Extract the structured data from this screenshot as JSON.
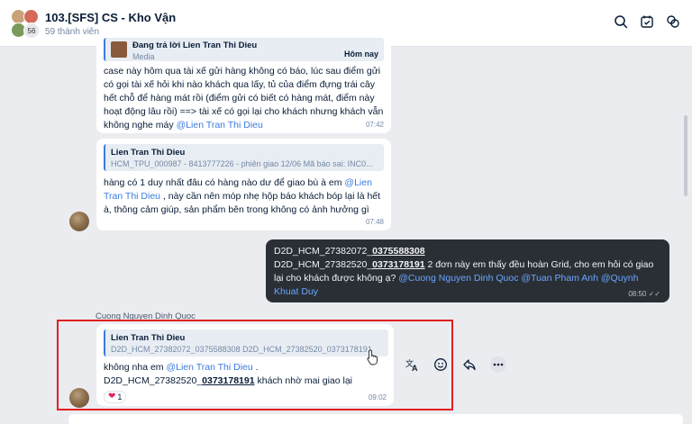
{
  "header": {
    "title": "103.[SFS] CS - Kho Vận",
    "members": "59 thành viên",
    "avatar_count": "56",
    "icons": [
      "search-icon",
      "calendar-check-icon",
      "sync-chat-icon"
    ]
  },
  "messages": {
    "m1": {
      "reply_label": "Đang trả lời Lien Tran Thi Dieu",
      "reply_sub": "Media",
      "reply_time": "Hôm nay",
      "text": "case này hôm qua tài xế gửi hàng không có báo, lúc sau điểm gửi có gọi tài xế hỏi khi nào khách qua lấy, tủ của điểm đựng trái cây hết chỗ để hàng mát rồi (điểm gửi có biết có hàng mát, điểm này hoạt động lâu rồi) ==> tài xế có gọi lại cho khách nhưng khách vẫn không nghe máy",
      "mention": "@Lien Tran Thi Dieu",
      "time": "07:42"
    },
    "m2": {
      "quote_name": "Lien Tran Thi Dieu",
      "quote_text": "HCM_TPU_000987 - 8413777226 - phiên giao 12/06 Mã báo sai: INC0...",
      "text_a": "hàng có 1 duy nhất đâu có hàng nào dư để giao bù à em ",
      "mention": "@Lien Tran Thi Dieu",
      "text_b": " , này cần nên móp nhẹ hộp báo khách bóp lại là hết à, thông cảm giúp, sản phẩm bên trong không có ảnh hưởng gì",
      "time": "07:48"
    },
    "m3": {
      "line1_a": "D2D_HCM_27382072_",
      "line1_b": "0375588308",
      "line2_a": "D2D_HCM_27382520_",
      "line2_b": "0373178191",
      "line2_c": " 2 đơn này em thấy đều hoàn Grid, cho em hỏi có giao lại cho khách được không ạ? ",
      "mentions": "@Cuong Nguyen Dinh Quoc @Tuan Pham Anh @Quynh Khuat Duy",
      "time": "08:50"
    },
    "m4": {
      "sender": "Cuong Nguyen Dinh Quoc",
      "quote_name": "Lien Tran Thi Dieu",
      "quote_text": "D2D_HCM_27382072_0375588308 D2D_HCM_27382520_0373178191",
      "text_a": "không nha em ",
      "mention": "@Lien Tran Thi Dieu",
      "text_b": " .",
      "line2_a": "D2D_HCM_27382520_",
      "line2_b": "0373178191",
      "line2_c": " khách nhờ mai giao lại",
      "reaction_count": "1",
      "time": "09:02"
    }
  },
  "hover_actions": [
    "translate-icon",
    "emoji-icon",
    "reply-icon",
    "more-icon"
  ]
}
